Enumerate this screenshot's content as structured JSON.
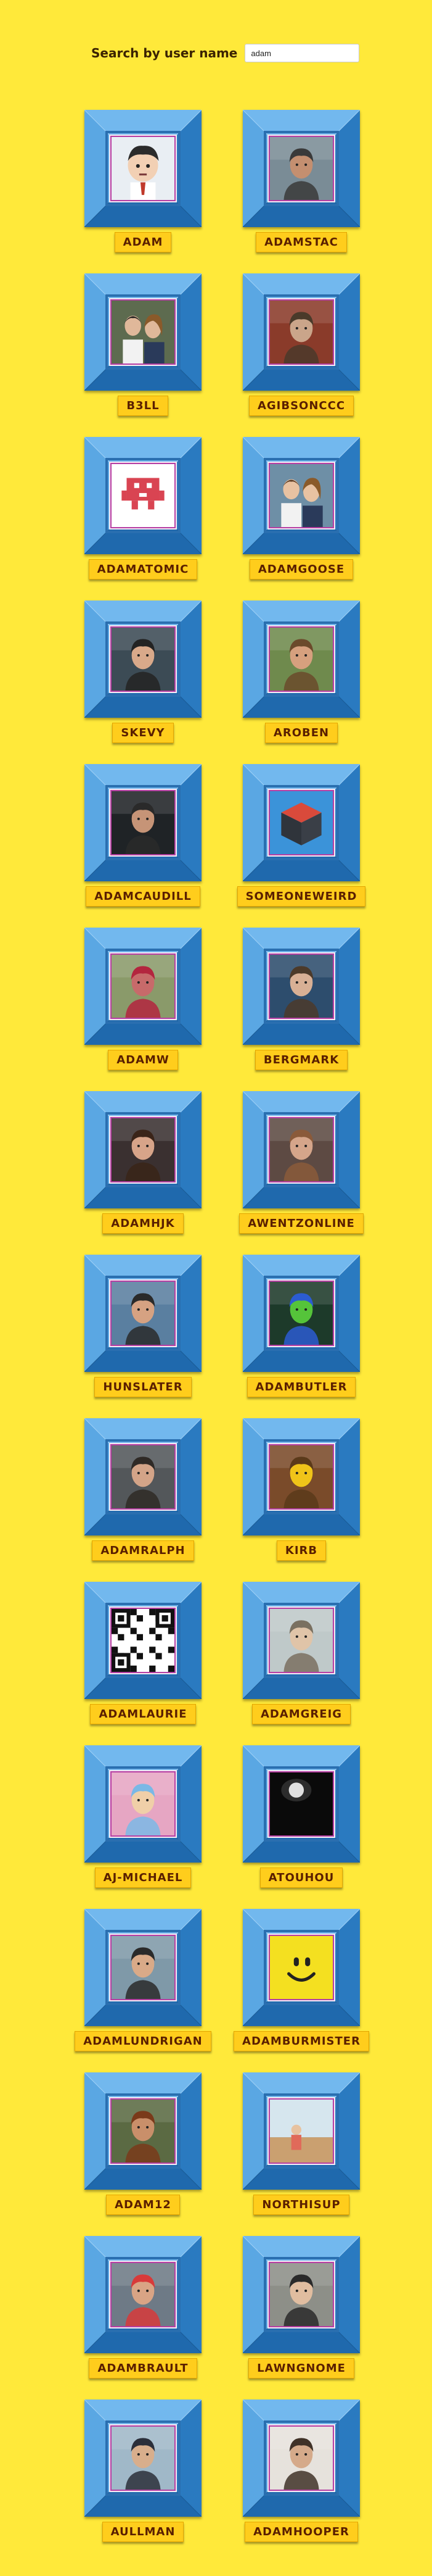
{
  "search": {
    "label": "Search by user name",
    "value": "adam"
  },
  "colors": {
    "background": "#ffe93a",
    "frame": "#3b93d9",
    "name_tag": "#ffcd1c",
    "name_text": "#5a1f00",
    "photo_border": "#b63fa3"
  },
  "users": [
    {
      "name": "ADAM",
      "avatar": "cartoon-character-icon"
    },
    {
      "name": "ADAMSTAC",
      "avatar": "person-photo"
    },
    {
      "name": "B3LL",
      "avatar": "couple-photo"
    },
    {
      "name": "AGIBSONCCC",
      "avatar": "person-photo"
    },
    {
      "name": "ADAMATOMIC",
      "avatar": "pixel-invader-icon"
    },
    {
      "name": "ADAMGOOSE",
      "avatar": "couple-photo"
    },
    {
      "name": "SKEVY",
      "avatar": "person-photo"
    },
    {
      "name": "AROBEN",
      "avatar": "person-photo"
    },
    {
      "name": "ADAMCAUDILL",
      "avatar": "person-photo"
    },
    {
      "name": "SOMEONEWEIRD",
      "avatar": "cube-icon"
    },
    {
      "name": "ADAMW",
      "avatar": "person-photo"
    },
    {
      "name": "BERGMARK",
      "avatar": "person-photo"
    },
    {
      "name": "ADAMHJK",
      "avatar": "person-photo"
    },
    {
      "name": "AWENTZONLINE",
      "avatar": "person-photo"
    },
    {
      "name": "HUNSLATER",
      "avatar": "person-photo"
    },
    {
      "name": "ADAMBUTLER",
      "avatar": "person-photo"
    },
    {
      "name": "ADAMRALPH",
      "avatar": "person-photo"
    },
    {
      "name": "KIRB",
      "avatar": "person-photo"
    },
    {
      "name": "ADAMLAURIE",
      "avatar": "qr-code-icon"
    },
    {
      "name": "ADAMGREIG",
      "avatar": "person-photo"
    },
    {
      "name": "AJ-MICHAEL",
      "avatar": "person-photo"
    },
    {
      "name": "ATOUHOU",
      "avatar": "dark-photo"
    },
    {
      "name": "ADAMLUNDRIGAN",
      "avatar": "person-photo"
    },
    {
      "name": "ADAMBURMISTER",
      "avatar": "smiley-face-icon"
    },
    {
      "name": "ADAM12",
      "avatar": "person-photo"
    },
    {
      "name": "NORTHISUP",
      "avatar": "beach-photo"
    },
    {
      "name": "ADAMBRAULT",
      "avatar": "person-photo"
    },
    {
      "name": "LAWNGNOME",
      "avatar": "person-photo"
    },
    {
      "name": "AULLMAN",
      "avatar": "person-photo"
    },
    {
      "name": "ADAMHOOPER",
      "avatar": "person-photo"
    }
  ]
}
